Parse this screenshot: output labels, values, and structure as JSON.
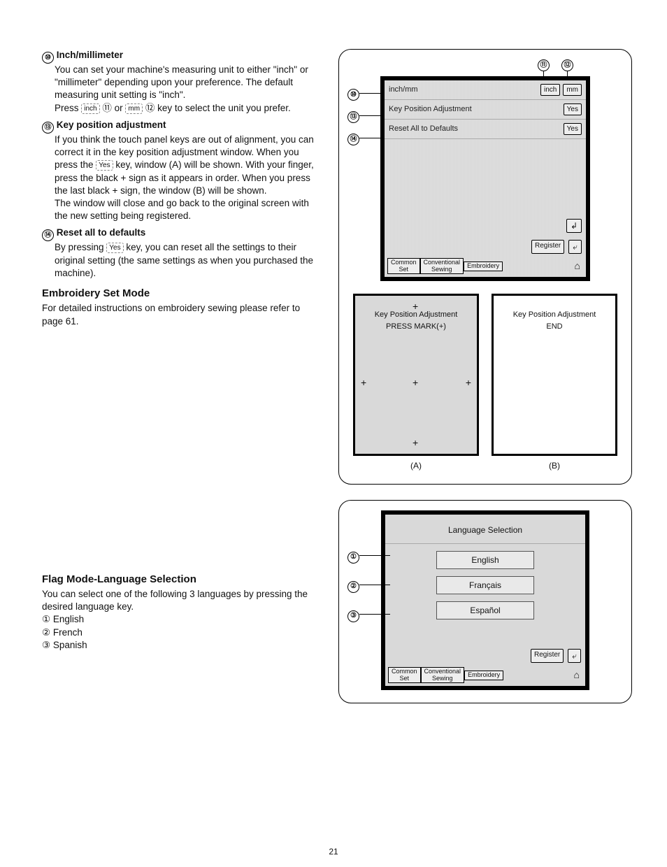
{
  "left": {
    "s10": {
      "num": "⑩",
      "title": "Inch/millimeter",
      "body1": "You can set your machine's measuring unit to either \"inch\" or \"millimeter\" depending upon your preference. The default measuring unit setting is \"inch\".",
      "body2a": "Press ",
      "key1": "inch",
      "ref11": "⑪",
      "or": " or ",
      "key2": "mm",
      "ref12": "⑫",
      "body2b": " key to select the unit you prefer."
    },
    "s13": {
      "num": "⑬",
      "title": "Key position adjustment",
      "body1": "If you think the touch panel keys are out of alignment, you can correct it in the key position adjustment window. When you press the ",
      "keyyes": "Yes",
      "body1b": " key, window (A) will be shown. With your finger, press the black + sign as it appears in order. When you press the last black + sign, the window (B) will be shown.",
      "body2": "The window will close and go back to the original screen with the new setting being registered."
    },
    "s14": {
      "num": "⑭",
      "title": "Reset all to defaults",
      "body1": "By pressing ",
      "keyyes": "Yes",
      "body1b": " key, you can reset all the settings to their original setting (the same settings as when you purchased the machine)."
    },
    "emb": {
      "title": "Embroidery Set Mode",
      "body": "For detailed instructions on embroidery sewing please refer to page 61."
    },
    "flag": {
      "title": "Flag Mode-Language Selection",
      "body": "You can select one of the following 3 languages by pressing the desired language key.",
      "opts": [
        {
          "num": "①",
          "label": "English"
        },
        {
          "num": "②",
          "label": "French"
        },
        {
          "num": "③",
          "label": "Spanish"
        }
      ]
    }
  },
  "screen1": {
    "callouts": {
      "c11": "⑪",
      "c12": "⑫",
      "c10": "⑩",
      "c13": "⑬",
      "c14": "⑭"
    },
    "row1": {
      "label": "inch/mm",
      "btn1": "inch",
      "btn2": "mm"
    },
    "row2": {
      "label": "Key Position Adjustment",
      "btn": "Yes"
    },
    "row3": {
      "label": "Reset All to Defaults",
      "btn": "Yes"
    },
    "arrow": "↲",
    "register": "Register",
    "returnicon": "⤶",
    "tabs": {
      "t1": "Common\nSet",
      "t2": "Conventional\nSewing",
      "t3": "Embroidery"
    },
    "homeicon": "⌂"
  },
  "calA": {
    "l1": "Key Position Adjustment",
    "l2": "PRESS MARK(+)",
    "cap": "(A)"
  },
  "calB": {
    "l1": "Key Position Adjustment",
    "l2": "END",
    "cap": "(B)"
  },
  "screen2": {
    "callouts": {
      "c1": "①",
      "c2": "②",
      "c3": "③"
    },
    "title": "Language Selection",
    "b1": "English",
    "b2": "Français",
    "b3": "Español",
    "register": "Register",
    "returnicon": "⤶",
    "tabs": {
      "t1": "Common\nSet",
      "t2": "Conventional\nSewing",
      "t3": "Embroidery"
    },
    "homeicon": "⌂"
  },
  "pagenum": "21"
}
